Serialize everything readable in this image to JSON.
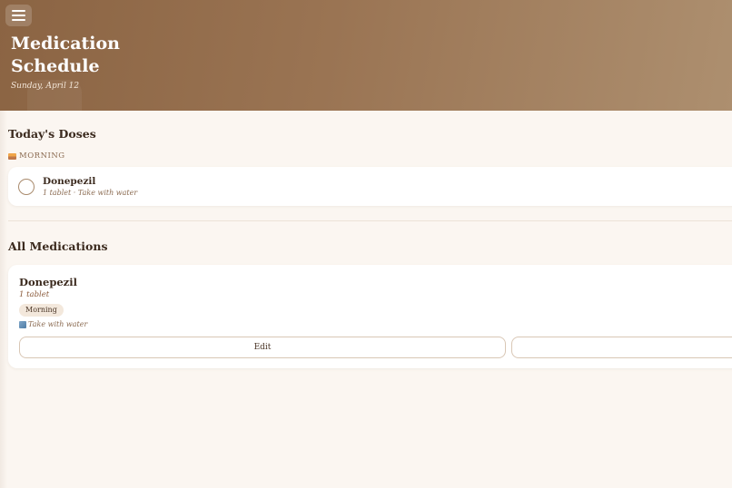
{
  "header": {
    "title": "Medication Schedule",
    "date": "Sunday, April 12"
  },
  "today": {
    "heading": "Today's Doses",
    "slots": [
      {
        "label": "MORNING",
        "icon": "sunrise-icon",
        "doses": [
          {
            "name": "Donepezil",
            "detail": "1 tablet · Take with water",
            "taken": false
          }
        ]
      }
    ]
  },
  "all": {
    "heading": "All Medications",
    "medications": [
      {
        "name": "Donepezil",
        "dose": "1 tablet",
        "time": "Morning",
        "note": "Take with water",
        "note_icon": "note-icon",
        "edit_label": "Edit",
        "second_label": ""
      }
    ]
  },
  "colors": {
    "header_start": "#8b6443",
    "header_end": "#ad8f6f",
    "background": "#fbf6f1",
    "badge": "#f3e8dc"
  }
}
